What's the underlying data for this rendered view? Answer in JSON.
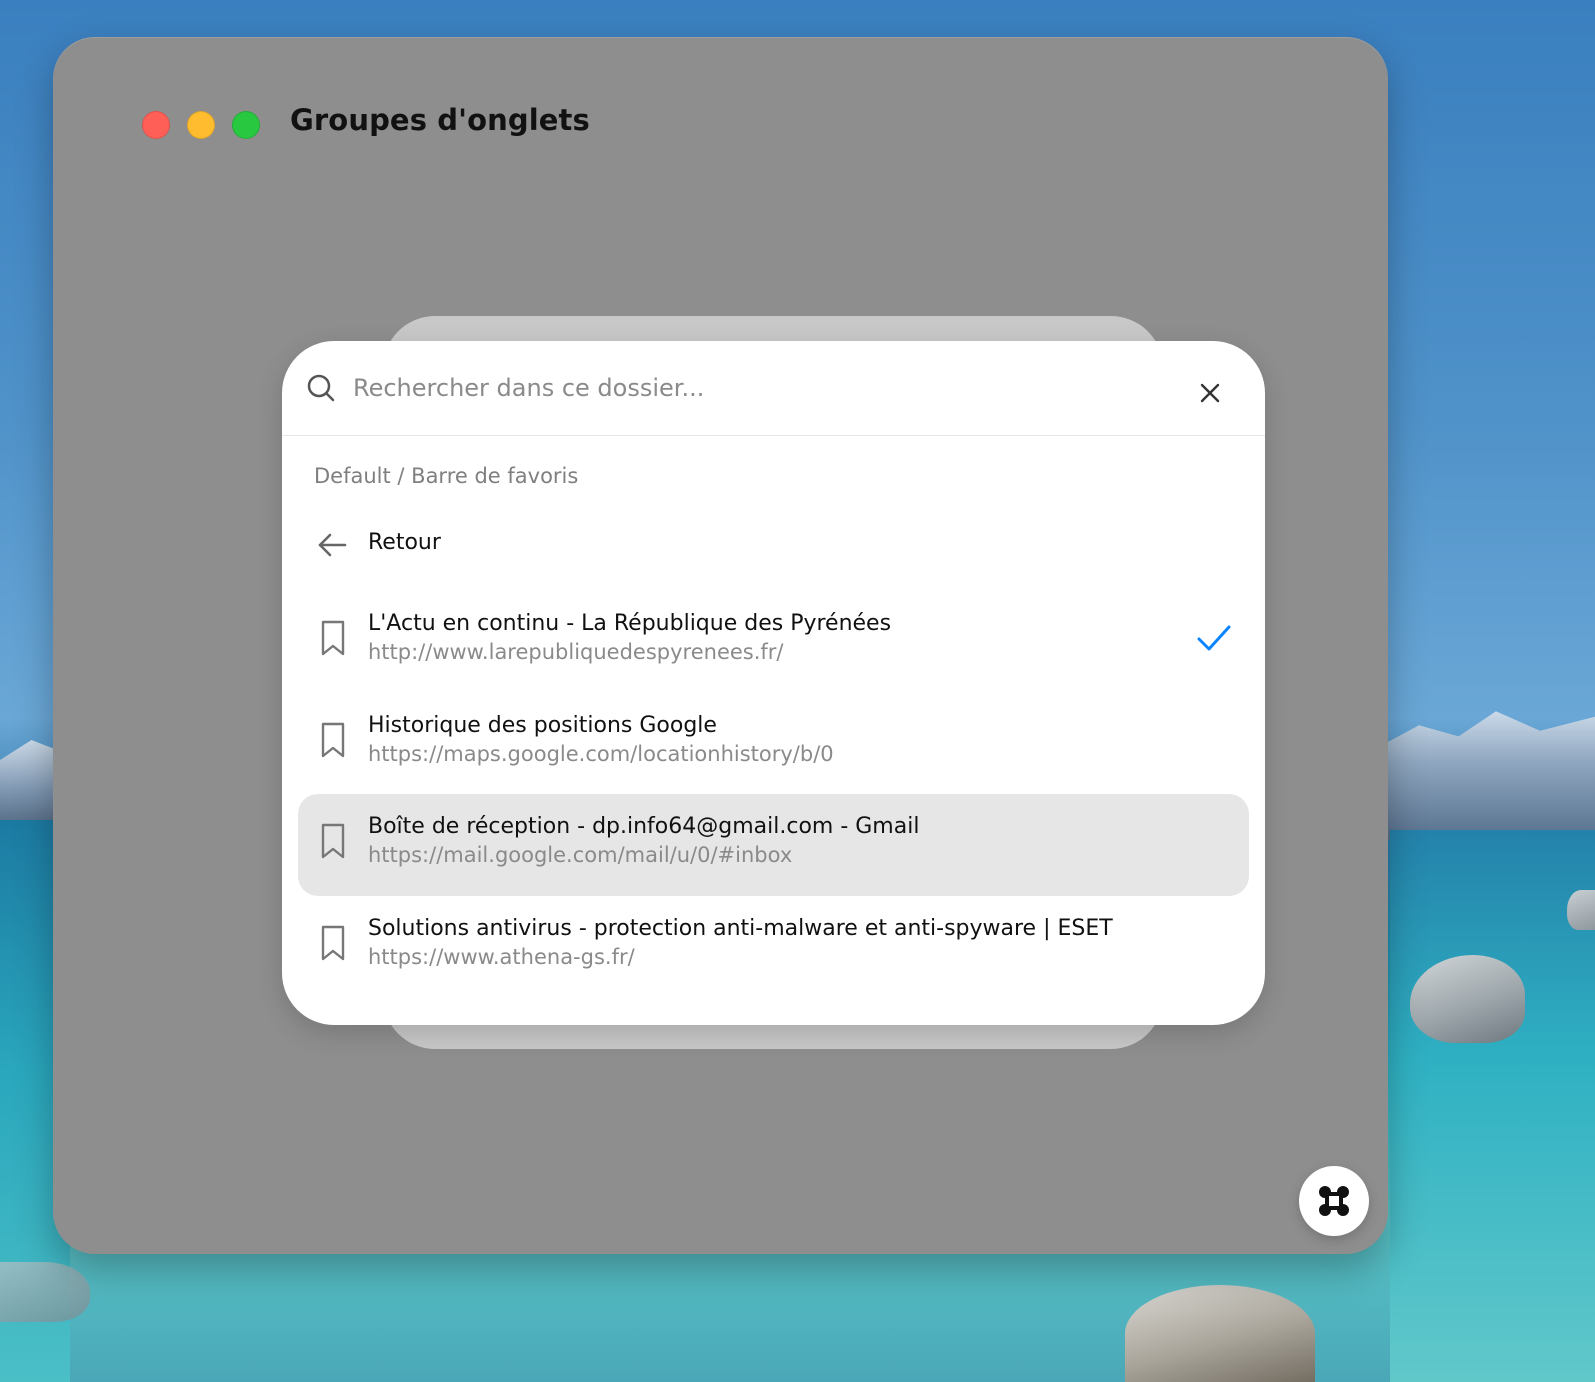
{
  "window": {
    "title": "Groupes d'onglets"
  },
  "search": {
    "placeholder": "Rechercher dans ce dossier..."
  },
  "breadcrumb": "Default / Barre de favoris",
  "back": {
    "label": "Retour"
  },
  "items": [
    {
      "title": "L'Actu en continu - La République des Pyrénées",
      "url": "http://www.larepubliquedespyrenees.fr/",
      "selected": true
    },
    {
      "title": "Historique des positions Google",
      "url": "https://maps.google.com/locationhistory/b/0",
      "selected": false
    },
    {
      "title": "Boîte de réception - dp.info64@gmail.com - Gmail",
      "url": "https://mail.google.com/mail/u/0/#inbox",
      "selected": false,
      "highlighted": true
    },
    {
      "title": "Solutions antivirus - protection anti-malware et anti-spyware | ESET",
      "url": "https://www.athena-gs.fr/",
      "selected": false
    }
  ],
  "colors": {
    "window_bg": "#8e8e8e",
    "panel_bg": "#ffffff",
    "hover_bg": "#e6e6e6",
    "accent": "#0a84ff",
    "traffic_red": "#ff5f57",
    "traffic_yellow": "#febc2e",
    "traffic_green": "#28c840"
  },
  "icons": {
    "search": "search-icon",
    "close": "close-icon",
    "back": "arrow-left-icon",
    "bookmark": "bookmark-icon",
    "selected": "check-icon",
    "fab": "command-key-icon"
  }
}
